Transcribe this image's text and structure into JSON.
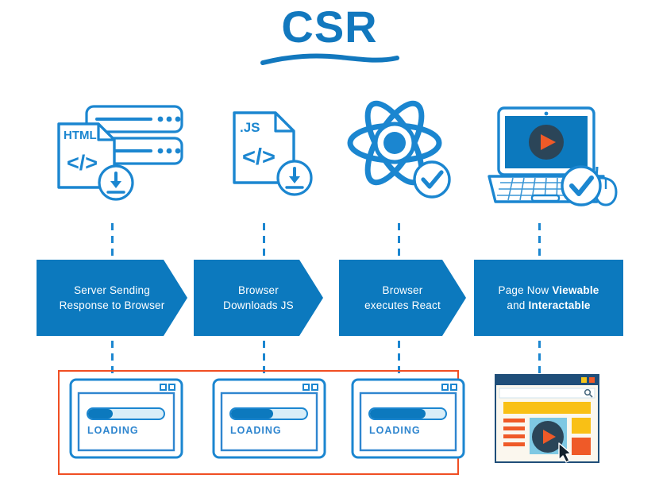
{
  "diagram": {
    "title": "CSR",
    "title_color": "#1278be",
    "accent_blue": "#0c79be",
    "sketch_blue": "#1b86d0",
    "highlight_red": "#f04e23",
    "underline_name": "title-underline-swoosh"
  },
  "icons": [
    {
      "name": "server-html-download-icon",
      "label_doc": "HTML",
      "code_glyph": "</>",
      "badge": "download-arrow",
      "description": "Server rack with HTML document and download badge"
    },
    {
      "name": "js-file-download-icon",
      "label_doc": ".JS",
      "code_glyph": "</>",
      "badge": "download-arrow",
      "description": "JavaScript file document with download badge"
    },
    {
      "name": "react-atom-check-icon",
      "label_doc": "",
      "code_glyph": "",
      "badge": "check-mark",
      "description": "React atom logo with check badge"
    },
    {
      "name": "laptop-play-check-icon",
      "label_doc": "",
      "code_glyph": "",
      "badge": "check-mark",
      "description": "Laptop showing video play button with mouse and check badge"
    }
  ],
  "steps": [
    {
      "name": "step-server-sending",
      "label": "Server Sending\nResponse to Browser",
      "shape": "chevron"
    },
    {
      "name": "step-browser-downloads-js",
      "label": "Browser\nDownloads JS",
      "shape": "chevron"
    },
    {
      "name": "step-browser-executes-react",
      "label": "Browser\nexecutes React",
      "shape": "chevron"
    },
    {
      "name": "step-page-viewable",
      "label_parts": [
        "Page Now ",
        "Viewable",
        "and ",
        "Interactable"
      ],
      "shape": "rectangle"
    }
  ],
  "loading_states": [
    {
      "name": "loading-window-1",
      "label": "LOADING",
      "progress": 33
    },
    {
      "name": "loading-window-2",
      "label": "LOADING",
      "progress": 55
    },
    {
      "name": "loading-window-3",
      "label": "LOADING",
      "progress": 72
    }
  ],
  "final_page": {
    "name": "rendered-page-window",
    "chrome_color": "#1f4e79",
    "dot_colors": [
      "#f5c518",
      "#ef5a28"
    ],
    "banner_color": "#f9c015",
    "line_color": "#ef5a28",
    "video_color": "#7ec8e3",
    "block_yellow": "#f9c015",
    "block_orange": "#ef5a28",
    "play_button": "play-triangle",
    "cursor": "mouse-pointer",
    "search_icon": "magnifier-icon"
  }
}
